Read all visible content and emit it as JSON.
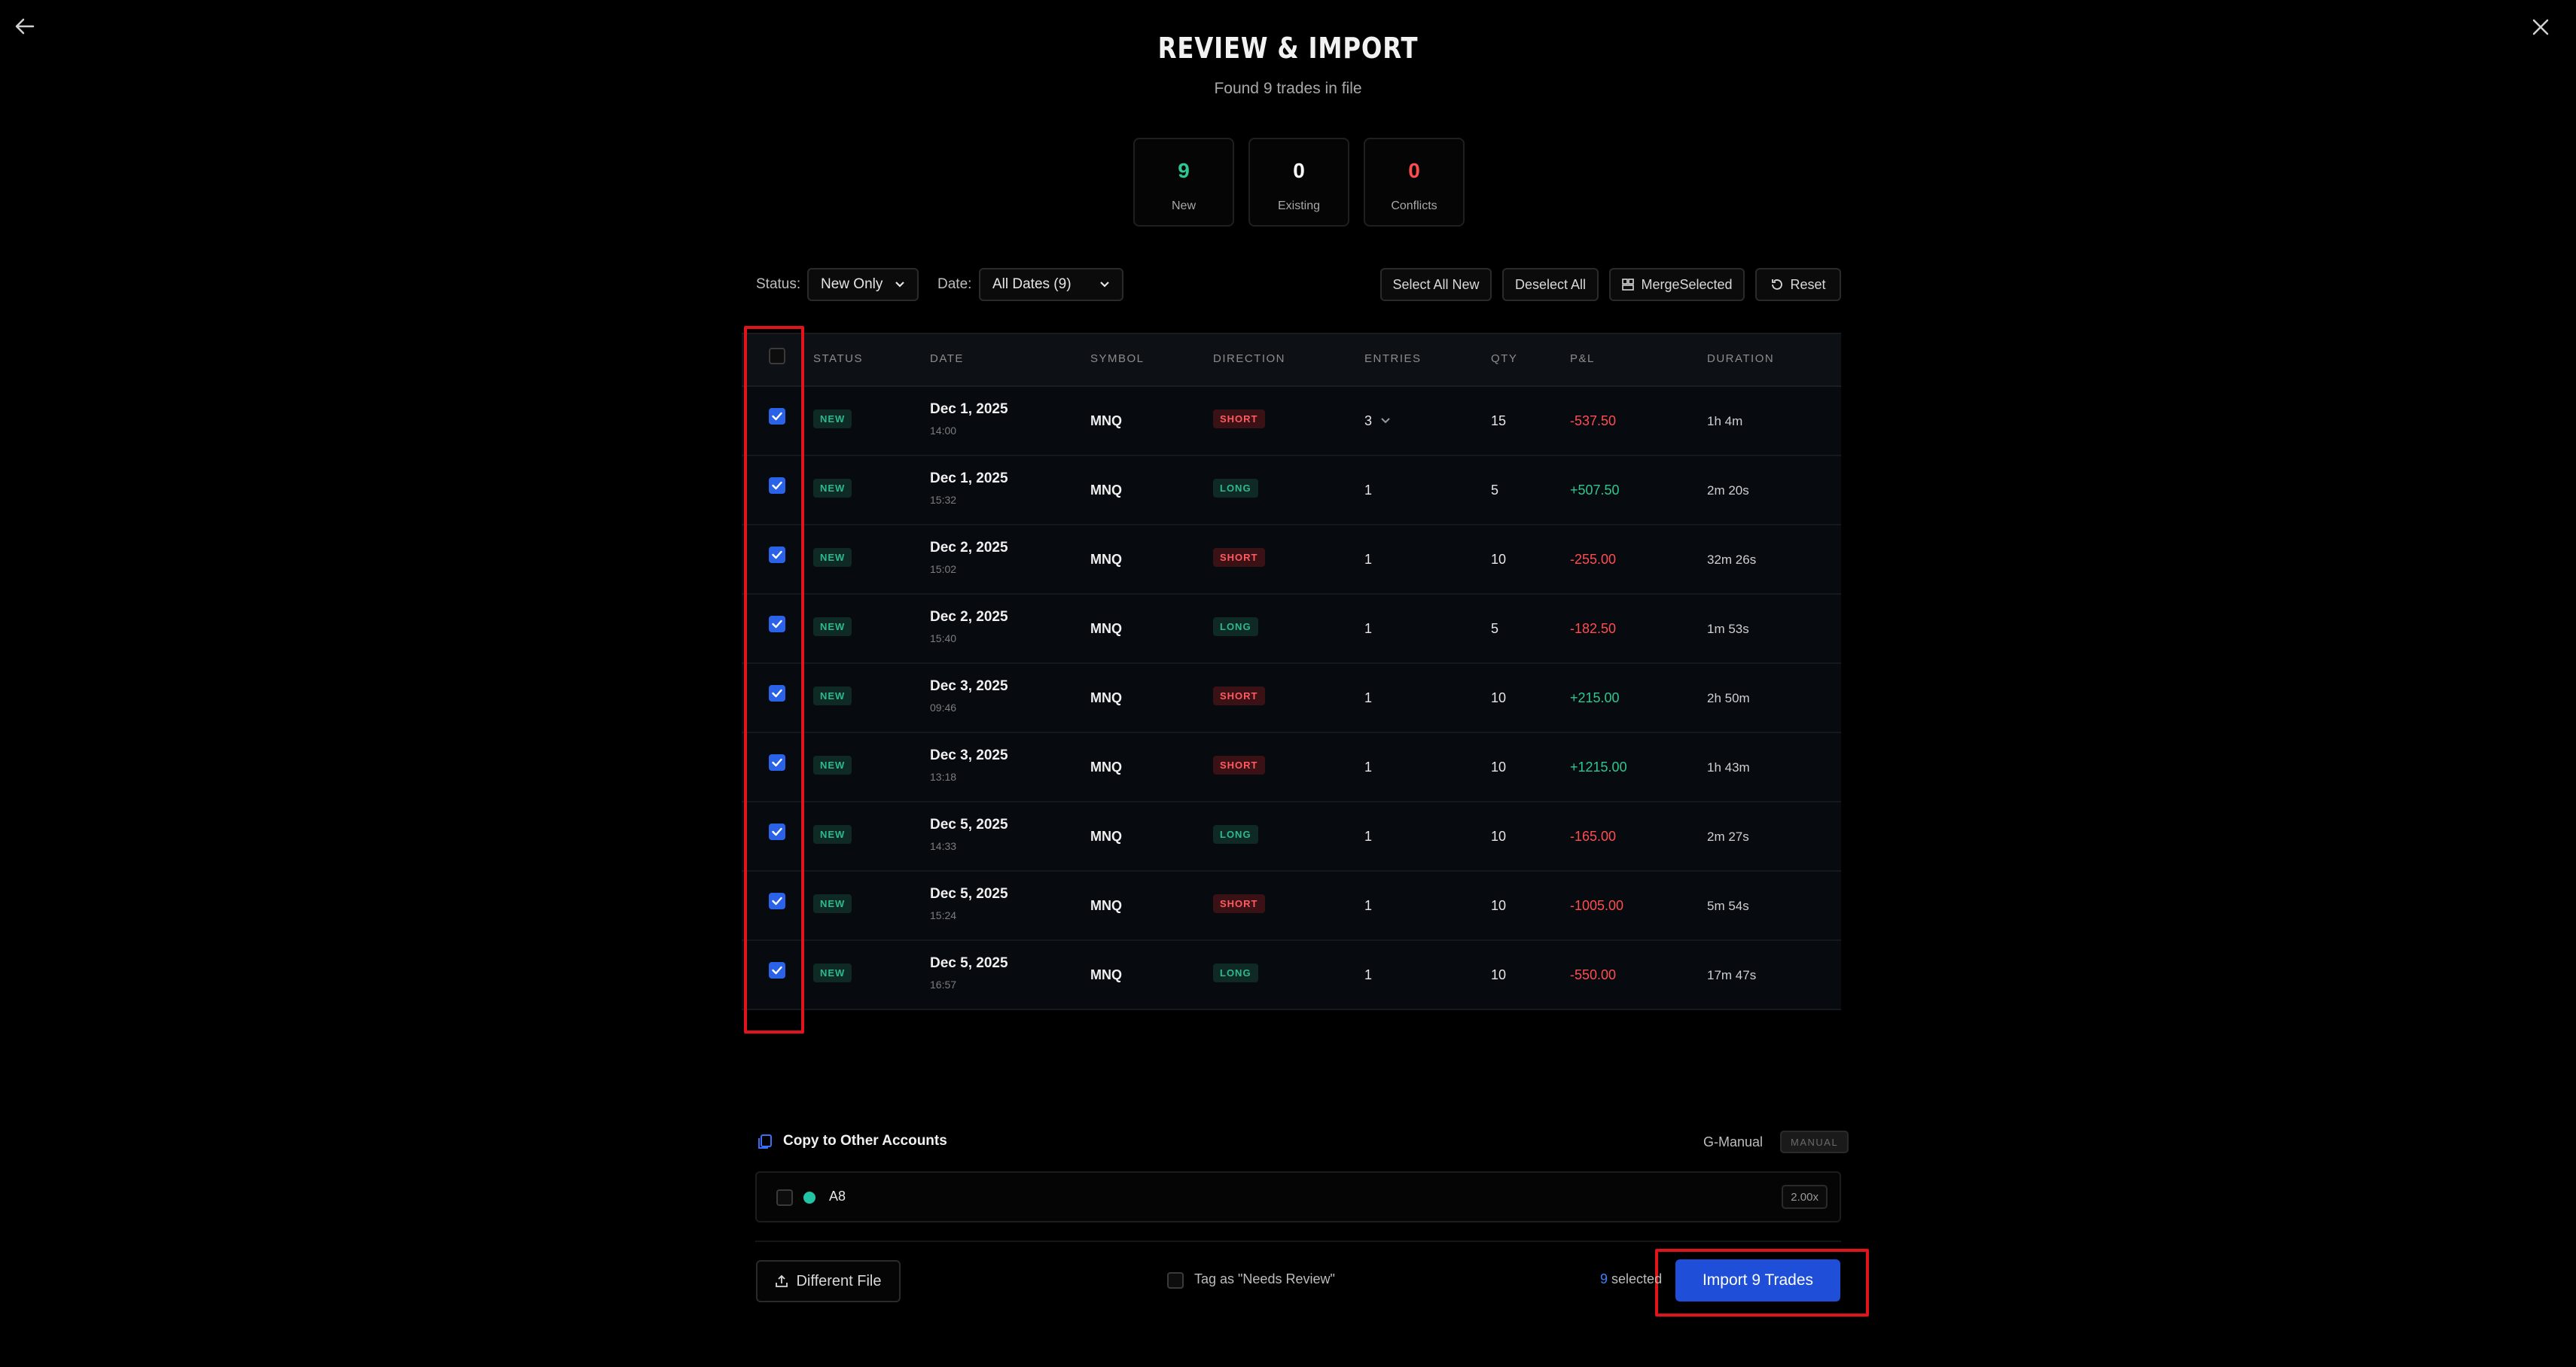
{
  "header": {
    "title": "REVIEW & IMPORT",
    "subtitle": "Found 9 trades in file"
  },
  "stats": [
    {
      "value": "9",
      "label": "New",
      "color": "#2cc88f"
    },
    {
      "value": "0",
      "label": "Existing",
      "color": "#ffffff"
    },
    {
      "value": "0",
      "label": "Conflicts",
      "color": "#ff4d4f"
    }
  ],
  "filters": {
    "status_label": "Status:",
    "status_value": "New Only",
    "date_label": "Date:",
    "date_value": "All Dates (9)"
  },
  "actions": {
    "select_all_new": "Select All New",
    "deselect_all": "Deselect All",
    "merge_selected": "MergeSelected",
    "reset": "Reset"
  },
  "table": {
    "columns": [
      "STATUS",
      "DATE",
      "SYMBOL",
      "DIRECTION",
      "ENTRIES",
      "QTY",
      "P&L",
      "DURATION"
    ],
    "rows": [
      {
        "status": "NEW",
        "date": "Dec 1, 2025",
        "time": "14:00",
        "symbol": "MNQ",
        "direction": "SHORT",
        "entries": "3",
        "qty": "15",
        "pnl": "-537.50",
        "duration": "1h 4m"
      },
      {
        "status": "NEW",
        "date": "Dec 1, 2025",
        "time": "15:32",
        "symbol": "MNQ",
        "direction": "LONG",
        "entries": "1",
        "qty": "5",
        "pnl": "+507.50",
        "duration": "2m 20s"
      },
      {
        "status": "NEW",
        "date": "Dec 2, 2025",
        "time": "15:02",
        "symbol": "MNQ",
        "direction": "SHORT",
        "entries": "1",
        "qty": "10",
        "pnl": "-255.00",
        "duration": "32m 26s"
      },
      {
        "status": "NEW",
        "date": "Dec 2, 2025",
        "time": "15:40",
        "symbol": "MNQ",
        "direction": "LONG",
        "entries": "1",
        "qty": "5",
        "pnl": "-182.50",
        "duration": "1m 53s"
      },
      {
        "status": "NEW",
        "date": "Dec 3, 2025",
        "time": "09:46",
        "symbol": "MNQ",
        "direction": "SHORT",
        "entries": "1",
        "qty": "10",
        "pnl": "+215.00",
        "duration": "2h 50m"
      },
      {
        "status": "NEW",
        "date": "Dec 3, 2025",
        "time": "13:18",
        "symbol": "MNQ",
        "direction": "SHORT",
        "entries": "1",
        "qty": "10",
        "pnl": "+1215.00",
        "duration": "1h 43m"
      },
      {
        "status": "NEW",
        "date": "Dec 5, 2025",
        "time": "14:33",
        "symbol": "MNQ",
        "direction": "LONG",
        "entries": "1",
        "qty": "10",
        "pnl": "-165.00",
        "duration": "2m 27s"
      },
      {
        "status": "NEW",
        "date": "Dec 5, 2025",
        "time": "15:24",
        "symbol": "MNQ",
        "direction": "SHORT",
        "entries": "1",
        "qty": "10",
        "pnl": "-1005.00",
        "duration": "5m 54s"
      },
      {
        "status": "NEW",
        "date": "Dec 5, 2025",
        "time": "16:57",
        "symbol": "MNQ",
        "direction": "LONG",
        "entries": "1",
        "qty": "10",
        "pnl": "-550.00",
        "duration": "17m 47s"
      }
    ]
  },
  "copy": {
    "title": "Copy to Other Accounts",
    "source_account": "G-Manual",
    "source_badge": "MANUAL",
    "accounts": [
      {
        "name": "A8",
        "multiplier": "2.00x"
      }
    ]
  },
  "footer": {
    "different_file": "Different File",
    "tag_label": "Tag as \"Needs Review\"",
    "selected_count": "9",
    "selected_suffix": "selected",
    "import_label": "Import 9 Trades"
  }
}
